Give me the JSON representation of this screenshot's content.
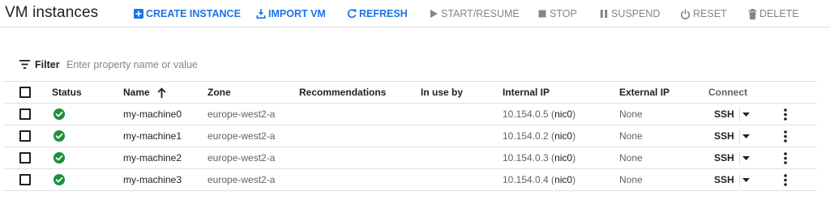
{
  "header": {
    "title": "VM instances",
    "actions": [
      {
        "label": "CREATE INSTANCE",
        "icon": "add-box-icon",
        "state": "active"
      },
      {
        "label": "IMPORT VM",
        "icon": "import-icon",
        "state": "active"
      },
      {
        "label": "REFRESH",
        "icon": "refresh-icon",
        "state": "active"
      },
      {
        "label": "START/RESUME",
        "icon": "play-icon",
        "state": "disabled"
      },
      {
        "label": "STOP",
        "icon": "stop-icon",
        "state": "disabled"
      },
      {
        "label": "SUSPEND",
        "icon": "pause-icon",
        "state": "disabled"
      },
      {
        "label": "RESET",
        "icon": "power-icon",
        "state": "disabled"
      },
      {
        "label": "DELETE",
        "icon": "trash-icon",
        "state": "disabled"
      }
    ]
  },
  "filter": {
    "label": "Filter",
    "placeholder": "Enter property name or value"
  },
  "table": {
    "columns": {
      "status": "Status",
      "name": "Name",
      "zone": "Zone",
      "recommendations": "Recommendations",
      "in_use_by": "In use by",
      "internal_ip": "Internal IP",
      "external_ip": "External IP",
      "connect": "Connect"
    },
    "sort": {
      "column": "name",
      "direction": "ascending"
    },
    "rows": [
      {
        "status": "running",
        "name": "my-machine0",
        "zone": "europe-west2-a",
        "recommendations": "",
        "in_use_by": "",
        "internal_ip": "10.154.0.5",
        "nic": "nic0",
        "external_ip": "None",
        "connect": "SSH"
      },
      {
        "status": "running",
        "name": "my-machine1",
        "zone": "europe-west2-a",
        "recommendations": "",
        "in_use_by": "",
        "internal_ip": "10.154.0.2",
        "nic": "nic0",
        "external_ip": "None",
        "connect": "SSH"
      },
      {
        "status": "running",
        "name": "my-machine2",
        "zone": "europe-west2-a",
        "recommendations": "",
        "in_use_by": "",
        "internal_ip": "10.154.0.3",
        "nic": "nic0",
        "external_ip": "None",
        "connect": "SSH"
      },
      {
        "status": "running",
        "name": "my-machine3",
        "zone": "europe-west2-a",
        "recommendations": "",
        "in_use_by": "",
        "internal_ip": "10.154.0.4",
        "nic": "nic0",
        "external_ip": "None",
        "connect": "SSH"
      }
    ]
  },
  "colors": {
    "accent": "#1a73e8",
    "status_running": "#1e8e3e",
    "disabled": "#80868b"
  }
}
